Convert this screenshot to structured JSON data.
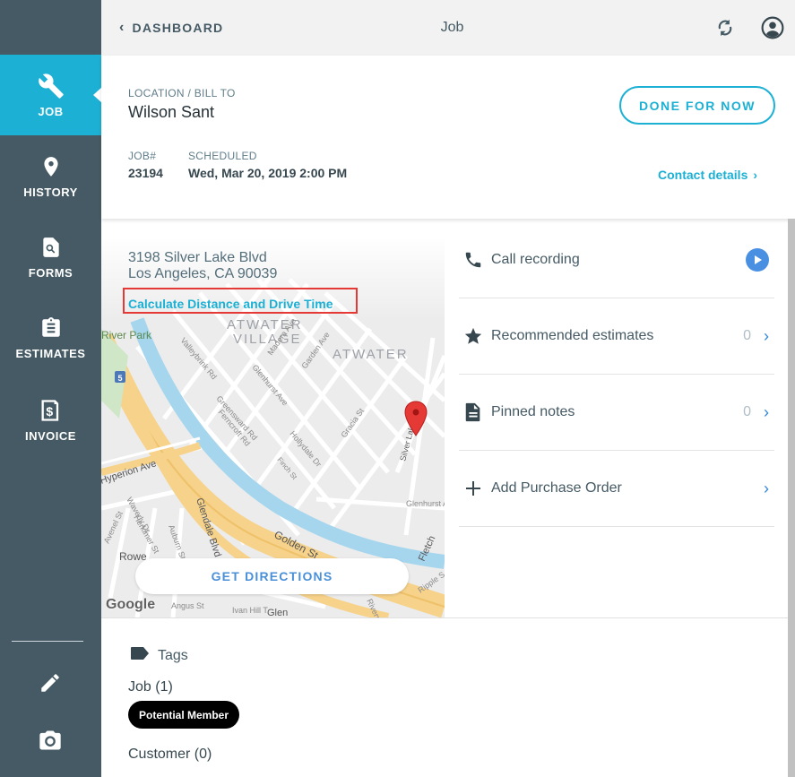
{
  "sidebar": {
    "items": [
      {
        "label": "JOB",
        "icon": "wrench-icon",
        "active": true
      },
      {
        "label": "HISTORY",
        "icon": "location-pin-icon"
      },
      {
        "label": "FORMS",
        "icon": "document-search-icon"
      },
      {
        "label": "ESTIMATES",
        "icon": "clipboard-icon"
      },
      {
        "label": "INVOICE",
        "icon": "invoice-dollar-icon"
      }
    ],
    "tools": [
      "pencil-icon",
      "camera-icon"
    ]
  },
  "topbar": {
    "back_label": "DASHBOARD",
    "title": "Job",
    "icons": [
      "sync-icon",
      "account-icon"
    ]
  },
  "header": {
    "location_caption": "LOCATION / BILL TO",
    "location_name": "Wilson Sant",
    "done_button": "DONE FOR NOW",
    "job_caption": "JOB#",
    "job_number": "23194",
    "scheduled_caption": "SCHEDULED",
    "scheduled_value": "Wed, Mar 20, 2019 2:00 PM",
    "contact_link": "Contact details"
  },
  "map": {
    "address_line1": "3198 Silver Lake Blvd",
    "address_line2": "Los Angeles, CA 90039",
    "calc_link": "Calculate Distance and Drive Time",
    "directions_button": "GET DIRECTIONS",
    "attribution": "Google",
    "labels": {
      "atwater_village_1": "ATWATER",
      "atwater_village_2": "VILLAGE",
      "atwater": "ATWATER",
      "river_park": "River Park",
      "hyperion": "Hyperion Ave",
      "glendale": "Glendale Blvd",
      "golden_state": "Golden St",
      "silver_lake": "Silver Lake",
      "glenhurst": "Glenhurst Ave",
      "gracia": "Gracia St",
      "ferncroft": "Ferncroft Rd",
      "greensward": "Greensward Rd",
      "valleybrink": "Valleybrink Rd",
      "madera": "Madera Ave",
      "garden": "Garden Ave",
      "hollydale": "Hollydale Dr",
      "fletcher": "Fletch",
      "ripple": "Ripple S",
      "rowe": "Rowe",
      "waverly": "Waverly Dr",
      "herkimer": "Herkimer St",
      "avenel": "Avenel St",
      "auburn": "Auburn St",
      "angus": "Angus St",
      "ivan_hill": "Ivan Hill T",
      "riverside": "Riversi",
      "glen": "Glen",
      "finch": "Finch St",
      "glenhurst_ave": "Glenhurst Ave",
      "freeway_shield": "5"
    }
  },
  "panels": [
    {
      "label": "Call recording",
      "icon": "phone-icon",
      "action": "play-icon"
    },
    {
      "label": "Recommended estimates",
      "icon": "star-icon",
      "count": "0"
    },
    {
      "label": "Pinned notes",
      "icon": "note-icon",
      "count": "0"
    },
    {
      "label": "Add Purchase Order",
      "icon": "plus-icon",
      "count": ""
    }
  ],
  "tags": {
    "title": "Tags",
    "job_header": "Job (1)",
    "job_tags": [
      "Potential Member"
    ],
    "customer_header": "Customer (0)"
  },
  "colors": {
    "sidebar": "#455a64",
    "accent": "#1cb0d4",
    "highlight_box": "#e53935",
    "link_blue": "#4a90d9"
  }
}
